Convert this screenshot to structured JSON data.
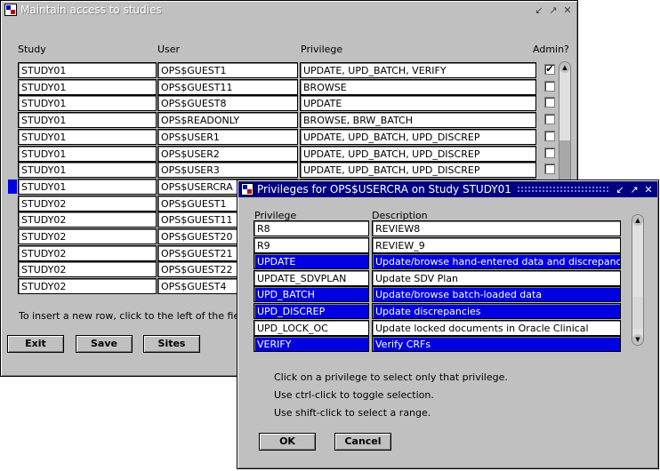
{
  "main_window": {
    "title": "Maintain access to studies",
    "headers": {
      "study": "Study",
      "user": "User",
      "privilege": "Privilege",
      "admin": "Admin?"
    },
    "rows": [
      {
        "study": "STUDY01",
        "user": "OPS$GUEST1",
        "privilege": "UPDATE, UPD_BATCH, VERIFY",
        "admin": "✔"
      },
      {
        "study": "STUDY01",
        "user": "OPS$GUEST11",
        "privilege": "BROWSE",
        "admin": ""
      },
      {
        "study": "STUDY01",
        "user": "OPS$GUEST8",
        "privilege": "UPDATE",
        "admin": ""
      },
      {
        "study": "STUDY01",
        "user": "OPS$READONLY",
        "privilege": "BROWSE, BRW_BATCH",
        "admin": ""
      },
      {
        "study": "STUDY01",
        "user": "OPS$USER1",
        "privilege": "UPDATE, UPD_BATCH, UPD_DISCREP",
        "admin": ""
      },
      {
        "study": "STUDY01",
        "user": "OPS$USER2",
        "privilege": "UPDATE, UPD_BATCH, UPD_DISCREP",
        "admin": ""
      },
      {
        "study": "STUDY01",
        "user": "OPS$USER3",
        "privilege": "UPDATE, UPD_BATCH, UPD_DISCREP",
        "admin": ""
      },
      {
        "study": "STUDY01",
        "user": "OPS$USERCRA",
        "privilege": "",
        "admin": ""
      },
      {
        "study": "STUDY02",
        "user": "OPS$GUEST1",
        "privilege": "",
        "admin": ""
      },
      {
        "study": "STUDY02",
        "user": "OPS$GUEST11",
        "privilege": "",
        "admin": ""
      },
      {
        "study": "STUDY02",
        "user": "OPS$GUEST20",
        "privilege": "",
        "admin": ""
      },
      {
        "study": "STUDY02",
        "user": "OPS$GUEST21",
        "privilege": "",
        "admin": ""
      },
      {
        "study": "STUDY02",
        "user": "OPS$GUEST22",
        "privilege": "",
        "admin": ""
      },
      {
        "study": "STUDY02",
        "user": "OPS$GUEST4",
        "privilege": "",
        "admin": ""
      }
    ],
    "hint": "To insert a new row, click to the left of the field on",
    "buttons": {
      "exit": "Exit",
      "save": "Save",
      "sites": "Sites"
    }
  },
  "dialog": {
    "title": "Privileges for OPS$USERCRA on Study STUDY01",
    "headers": {
      "privilege": "Privilege",
      "description": "Description"
    },
    "rows": [
      {
        "privilege": "R8",
        "description": "REVIEW8",
        "selected": false
      },
      {
        "privilege": "R9",
        "description": "REVIEW_9",
        "selected": false
      },
      {
        "privilege": "UPDATE",
        "description": "Update/browse hand-entered data and discrepancies",
        "selected": true
      },
      {
        "privilege": "UPDATE_SDVPLAN",
        "description": "Update SDV Plan",
        "selected": false
      },
      {
        "privilege": "UPD_BATCH",
        "description": "Update/browse batch-loaded data",
        "selected": true
      },
      {
        "privilege": "UPD_DISCREP",
        "description": "Update discrepancies",
        "selected": true
      },
      {
        "privilege": "UPD_LOCK_OC",
        "description": "Update locked documents in Oracle Clinical",
        "selected": false
      },
      {
        "privilege": "VERIFY",
        "description": "Verify CRFs",
        "selected": true
      }
    ],
    "instructions": [
      "Click on a privilege to select only that privilege.",
      "Use ctrl-click to toggle selection.",
      "Use shift-click to select a range."
    ],
    "buttons": {
      "ok": "OK",
      "cancel": "Cancel"
    }
  },
  "colors": {
    "selection": "#0000e0",
    "active_title": "#000080",
    "window_bg": "#c0c0c0"
  }
}
